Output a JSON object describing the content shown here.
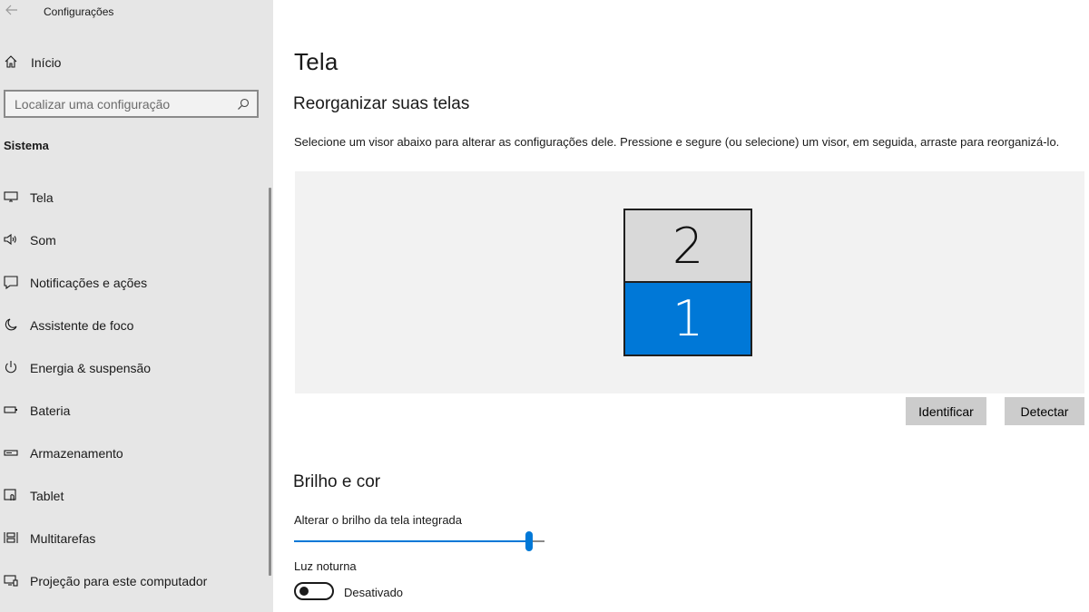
{
  "window": {
    "title": "Configurações"
  },
  "sidebar": {
    "home_label": "Início",
    "search_placeholder": "Localizar uma configuração",
    "section": "Sistema",
    "items": [
      {
        "label": "Tela",
        "icon": "monitor-icon"
      },
      {
        "label": "Som",
        "icon": "speaker-icon"
      },
      {
        "label": "Notificações e ações",
        "icon": "notification-icon"
      },
      {
        "label": "Assistente de foco",
        "icon": "moon-icon"
      },
      {
        "label": "Energia & suspensão",
        "icon": "power-icon"
      },
      {
        "label": "Bateria",
        "icon": "battery-icon"
      },
      {
        "label": "Armazenamento",
        "icon": "storage-icon"
      },
      {
        "label": "Tablet",
        "icon": "tablet-icon"
      },
      {
        "label": "Multitarefas",
        "icon": "multitasking-icon"
      },
      {
        "label": "Projeção para este computador",
        "icon": "projection-icon"
      }
    ]
  },
  "main": {
    "title": "Tela",
    "rearrange": {
      "heading": "Reorganizar suas telas",
      "description": "Selecione um visor abaixo para alterar as configurações dele. Pressione e segure (ou selecione) um visor, em seguida, arraste para reorganizá-lo.",
      "displays": [
        {
          "number": "2",
          "selected": false
        },
        {
          "number": "1",
          "selected": true
        }
      ],
      "identify_label": "Identificar",
      "detect_label": "Detectar"
    },
    "brightness": {
      "heading": "Brilho e cor",
      "slider_label": "Alterar o brilho da tela integrada",
      "value_percent": 95,
      "night_light_label": "Luz noturna",
      "night_light_state": "Desativado",
      "night_light_on": false
    }
  },
  "colors": {
    "accent": "#0078d7",
    "sidebar_bg": "#e6e6e6",
    "arrange_bg": "#f2f2f2",
    "button_bg": "#cccccc"
  }
}
